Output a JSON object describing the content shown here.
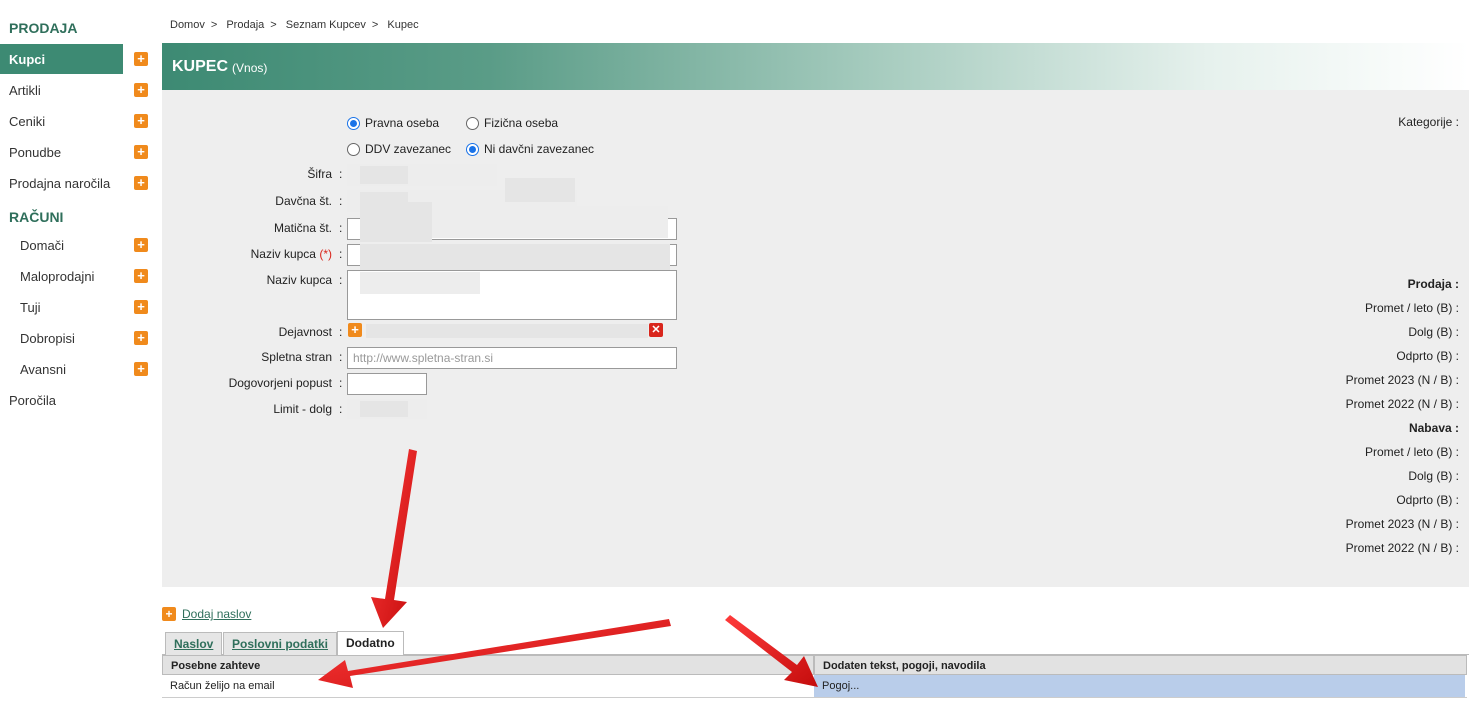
{
  "sidebar": {
    "section1": "PRODAJA",
    "items1": [
      {
        "label": "Kupci"
      },
      {
        "label": "Artikli"
      },
      {
        "label": "Ceniki"
      },
      {
        "label": "Ponudbe"
      },
      {
        "label": "Prodajna naročila"
      }
    ],
    "section2": "RAČUNI",
    "items2": [
      {
        "label": "Domači"
      },
      {
        "label": "Maloprodajni"
      },
      {
        "label": "Tuji"
      },
      {
        "label": "Dobropisi"
      },
      {
        "label": "Avansni"
      }
    ],
    "reports": "Poročila"
  },
  "breadcrumb": [
    "Domov",
    "Prodaja",
    "Seznam Kupcev",
    "Kupec"
  ],
  "breadcrumb_sep": ">",
  "header": {
    "title": "KUPEC",
    "subtitle": "(Vnos)"
  },
  "form": {
    "radio_legal": "Pravna oseba",
    "radio_natural": "Fizična oseba",
    "radio_vat": "DDV zavezanec",
    "radio_novat": "Ni davčni zavezanec",
    "selected_type": "Pravna oseba",
    "selected_vat": "Ni davčni zavezanec",
    "sifra": "Šifra",
    "davcna": "Davčna št.",
    "maticna": "Matična št.",
    "naziv1": "Naziv kupca",
    "naziv_req": "(*)",
    "naziv2": "Naziv kupca",
    "dejavnost": "Dejavnost",
    "spletna": "Spletna stran",
    "spletna_placeholder": "http://www.spletna-stran.si",
    "popust": "Dogovorjeni popust",
    "limit": "Limit - dolg",
    "colon": ":"
  },
  "right": {
    "kategorije": "Kategorije :",
    "prodaja": "Prodaja  :",
    "p_promet": "Promet / leto (B)  :",
    "p_dolg": "Dolg (B)  :",
    "p_odprto": "Odprto (B)  :",
    "p_2023": "Promet 2023 (N / B)  :",
    "p_2022": "Promet 2022 (N / B)  :",
    "nabava": "Nabava :",
    "n_promet": "Promet / leto (B)  :",
    "n_dolg": "Dolg (B)  :",
    "n_odprto": "Odprto (B)  :",
    "n_2023": "Promet 2023 (N / B)  :",
    "n_2022": "Promet 2022 (N / B)  :"
  },
  "add_address": "Dodaj naslov",
  "tabs": [
    "Naslov",
    "Poslovni podatki",
    "Dodatno"
  ],
  "active_tab": "Dodatno",
  "table": {
    "col1": "Posebne zahteve",
    "col2": "Dodaten tekst, pogoji, navodila",
    "row1_col1": "Račun želijo na email",
    "row1_col2": "Pogoj..."
  },
  "colors": {
    "accent": "#3d8a73",
    "plus": "#f08a1c",
    "arrow": "#e11b1b",
    "selected_cell": "#b9cdea"
  }
}
